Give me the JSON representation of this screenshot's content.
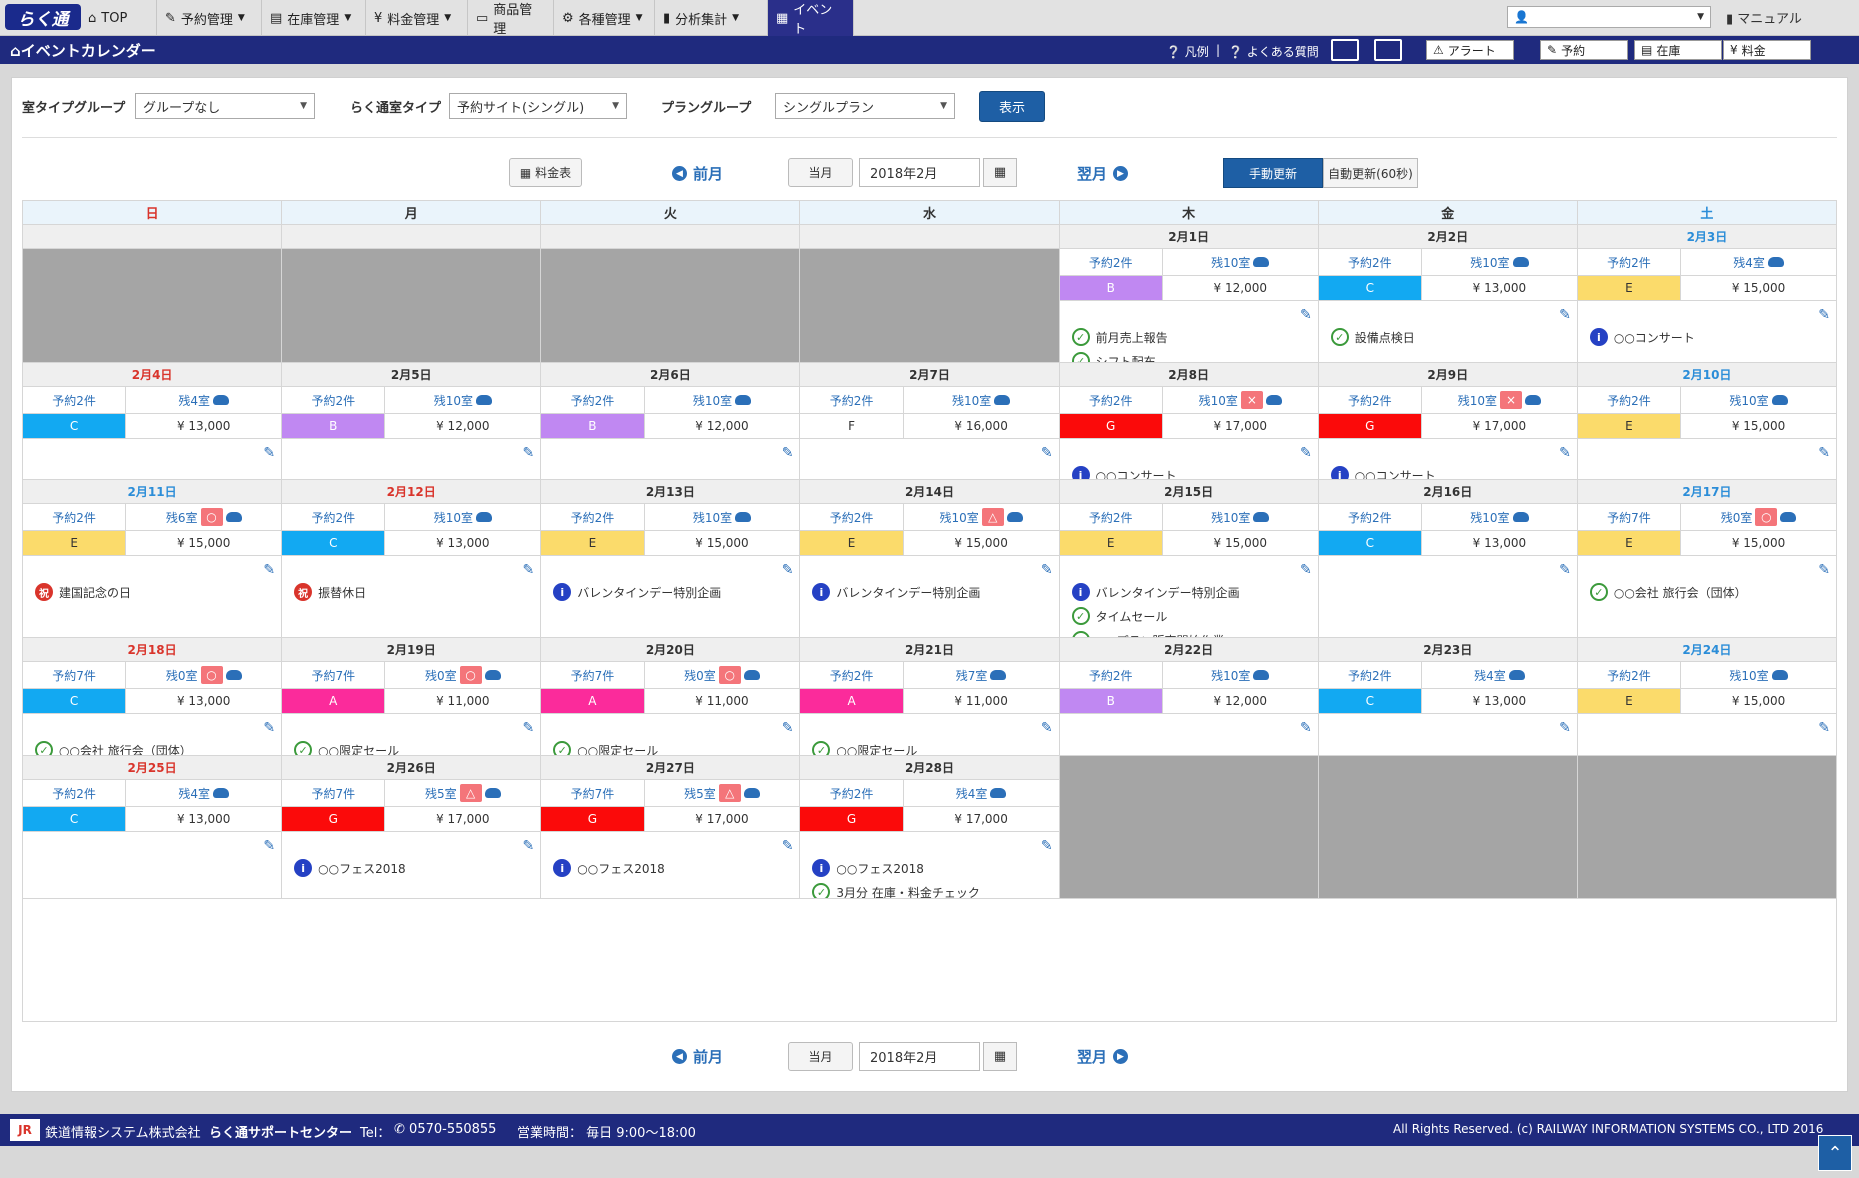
{
  "nav": {
    "logo": "らく通",
    "items": [
      {
        "label": "TOP",
        "icon": "home-icon",
        "dropdown": false,
        "active": false
      },
      {
        "label": "予約管理",
        "icon": "edit-icon",
        "dropdown": true,
        "active": false
      },
      {
        "label": "在庫管理",
        "icon": "list-icon",
        "dropdown": true,
        "active": false
      },
      {
        "label": "料金管理",
        "icon": "yen-icon",
        "dropdown": true,
        "active": false
      },
      {
        "label": "商品管理",
        "icon": "tag-icon",
        "dropdown": false,
        "active": false
      },
      {
        "label": "各種管理",
        "icon": "gear-icon",
        "dropdown": true,
        "active": false
      },
      {
        "label": "分析集計",
        "icon": "chart-icon",
        "dropdown": true,
        "active": false
      },
      {
        "label": "イベント",
        "icon": "calendar-icon",
        "dropdown": false,
        "active": true
      }
    ],
    "user_select": "",
    "manual": "マニュアル"
  },
  "titlebar": {
    "title": "イベントカレンダー",
    "legend": "凡例",
    "faq": "よくある質問",
    "alert": "アラート",
    "reserve": "予約",
    "stock": "在庫",
    "price": "料金"
  },
  "filters": {
    "roomtype_label": "室タイプグループ",
    "roomtype_value": "グループなし",
    "rakutsu_label": "らく通室タイプ",
    "rakutsu_value": "予約サイト(シングル)",
    "plan_label": "プラングループ",
    "plan_value": "シングルプラン",
    "show": "表示"
  },
  "controls": {
    "price_table": "料金表",
    "prev": "前月",
    "current": "当月",
    "month": "2018年2月",
    "next": "翌月",
    "manual_update": "手動更新",
    "auto_update": "自動更新(60秒)"
  },
  "calendar": {
    "weekdays": [
      "日",
      "月",
      "火",
      "水",
      "木",
      "金",
      "土"
    ],
    "weeks": [
      [
        null,
        null,
        null,
        null,
        {
          "date": "2月1日",
          "type": "",
          "resv": "予約2件",
          "remain": "残10室",
          "status": "",
          "plan": "B",
          "color": "#c088f2",
          "price": "¥ 12,000",
          "events": [
            {
              "t": "check",
              "text": "前月売上報告"
            },
            {
              "t": "check",
              "text": "シフト配布"
            }
          ]
        },
        {
          "date": "2月2日",
          "type": "",
          "resv": "予約2件",
          "remain": "残10室",
          "status": "",
          "plan": "C",
          "color": "#12a9f2",
          "price": "¥ 13,000",
          "events": [
            {
              "t": "check",
              "text": "設備点検日"
            }
          ]
        },
        {
          "date": "2月3日",
          "type": "sat",
          "resv": "予約2件",
          "remain": "残4室",
          "status": "",
          "plan": "E",
          "color": "#fbdb6b",
          "price": "¥ 15,000",
          "events": [
            {
              "t": "info",
              "text": "○○コンサート"
            }
          ]
        }
      ],
      [
        {
          "date": "2月4日",
          "type": "sun",
          "resv": "予約2件",
          "remain": "残4室",
          "status": "",
          "plan": "C",
          "color": "#12a9f2",
          "price": "¥ 13,000",
          "events": []
        },
        {
          "date": "2月5日",
          "type": "",
          "resv": "予約2件",
          "remain": "残10室",
          "status": "",
          "plan": "B",
          "color": "#c088f2",
          "price": "¥ 12,000",
          "events": []
        },
        {
          "date": "2月6日",
          "type": "",
          "resv": "予約2件",
          "remain": "残10室",
          "status": "",
          "plan": "B",
          "color": "#c088f2",
          "price": "¥ 12,000",
          "events": []
        },
        {
          "date": "2月7日",
          "type": "",
          "resv": "予約2件",
          "remain": "残10室",
          "status": "",
          "plan": "F",
          "color": "#ffffff",
          "price": "¥ 16,000",
          "events": []
        },
        {
          "date": "2月8日",
          "type": "",
          "resv": "予約2件",
          "remain": "残10室",
          "status": "×",
          "plan": "G",
          "color": "#fb0a0a",
          "price": "¥ 17,000",
          "events": [
            {
              "t": "info",
              "text": "○○コンサート"
            }
          ]
        },
        {
          "date": "2月9日",
          "type": "",
          "resv": "予約2件",
          "remain": "残10室",
          "status": "×",
          "plan": "G",
          "color": "#fb0a0a",
          "price": "¥ 17,000",
          "events": [
            {
              "t": "info",
              "text": "○○コンサート"
            }
          ]
        },
        {
          "date": "2月10日",
          "type": "sat",
          "resv": "予約2件",
          "remain": "残10室",
          "status": "",
          "plan": "E",
          "color": "#fbdb6b",
          "price": "¥ 15,000",
          "events": []
        }
      ],
      [
        {
          "date": "2月11日",
          "type": "sat",
          "resv": "予約2件",
          "remain": "残6室",
          "status": "○",
          "plan": "E",
          "color": "#fbdb6b",
          "price": "¥ 15,000",
          "events": [
            {
              "t": "holiday",
              "text": "建国記念の日"
            }
          ]
        },
        {
          "date": "2月12日",
          "type": "sun",
          "resv": "予約2件",
          "remain": "残10室",
          "status": "",
          "plan": "C",
          "color": "#12a9f2",
          "price": "¥ 13,000",
          "events": [
            {
              "t": "holiday",
              "text": "振替休日"
            }
          ]
        },
        {
          "date": "2月13日",
          "type": "",
          "resv": "予約2件",
          "remain": "残10室",
          "status": "",
          "plan": "E",
          "color": "#fbdb6b",
          "price": "¥ 15,000",
          "events": [
            {
              "t": "info",
              "text": "バレンタインデー特別企画"
            }
          ]
        },
        {
          "date": "2月14日",
          "type": "",
          "resv": "予約2件",
          "remain": "残10室",
          "status": "△",
          "plan": "E",
          "color": "#fbdb6b",
          "price": "¥ 15,000",
          "events": [
            {
              "t": "info",
              "text": "バレンタインデー特別企画"
            }
          ]
        },
        {
          "date": "2月15日",
          "type": "",
          "resv": "予約2件",
          "remain": "残10室",
          "status": "",
          "plan": "E",
          "color": "#fbdb6b",
          "price": "¥ 15,000",
          "events": [
            {
              "t": "info",
              "text": "バレンタインデー特別企画"
            },
            {
              "t": "check",
              "text": "タイムセール"
            },
            {
              "t": "check",
              "text": "○○プラン販売開始作業"
            }
          ]
        },
        {
          "date": "2月16日",
          "type": "",
          "resv": "予約2件",
          "remain": "残10室",
          "status": "",
          "plan": "C",
          "color": "#12a9f2",
          "price": "¥ 13,000",
          "events": []
        },
        {
          "date": "2月17日",
          "type": "sat",
          "resv": "予約7件",
          "remain": "残0室",
          "status": "○",
          "plan": "E",
          "color": "#fbdb6b",
          "price": "¥ 15,000",
          "events": [
            {
              "t": "check",
              "text": "○○会社 旅行会（団体）"
            }
          ]
        }
      ],
      [
        {
          "date": "2月18日",
          "type": "sun",
          "resv": "予約7件",
          "remain": "残0室",
          "status": "○",
          "plan": "C",
          "color": "#12a9f2",
          "price": "¥ 13,000",
          "events": [
            {
              "t": "check",
              "text": "○○会社 旅行会（団体）"
            }
          ]
        },
        {
          "date": "2月19日",
          "type": "",
          "resv": "予約7件",
          "remain": "残0室",
          "status": "○",
          "plan": "A",
          "color": "#fb2b9b",
          "price": "¥ 11,000",
          "events": [
            {
              "t": "check",
              "text": "○○限定セール"
            }
          ]
        },
        {
          "date": "2月20日",
          "type": "",
          "resv": "予約7件",
          "remain": "残0室",
          "status": "○",
          "plan": "A",
          "color": "#fb2b9b",
          "price": "¥ 11,000",
          "events": [
            {
              "t": "check",
              "text": "○○限定セール"
            }
          ]
        },
        {
          "date": "2月21日",
          "type": "",
          "resv": "予約2件",
          "remain": "残7室",
          "status": "",
          "plan": "A",
          "color": "#fb2b9b",
          "price": "¥ 11,000",
          "events": [
            {
              "t": "check",
              "text": "○○限定セール"
            }
          ]
        },
        {
          "date": "2月22日",
          "type": "",
          "resv": "予約2件",
          "remain": "残10室",
          "status": "",
          "plan": "B",
          "color": "#c088f2",
          "price": "¥ 12,000",
          "events": []
        },
        {
          "date": "2月23日",
          "type": "",
          "resv": "予約2件",
          "remain": "残4室",
          "status": "",
          "plan": "C",
          "color": "#12a9f2",
          "price": "¥ 13,000",
          "events": []
        },
        {
          "date": "2月24日",
          "type": "sat",
          "resv": "予約2件",
          "remain": "残10室",
          "status": "",
          "plan": "E",
          "color": "#fbdb6b",
          "price": "¥ 15,000",
          "events": []
        }
      ],
      [
        {
          "date": "2月25日",
          "type": "sun",
          "resv": "予約2件",
          "remain": "残4室",
          "status": "",
          "plan": "C",
          "color": "#12a9f2",
          "price": "¥ 13,000",
          "events": []
        },
        {
          "date": "2月26日",
          "type": "",
          "resv": "予約7件",
          "remain": "残5室",
          "status": "△",
          "plan": "G",
          "color": "#fb0a0a",
          "price": "¥ 17,000",
          "events": [
            {
              "t": "info",
              "text": "○○フェス2018"
            }
          ]
        },
        {
          "date": "2月27日",
          "type": "",
          "resv": "予約7件",
          "remain": "残5室",
          "status": "△",
          "plan": "G",
          "color": "#fb0a0a",
          "price": "¥ 17,000",
          "events": [
            {
              "t": "info",
              "text": "○○フェス2018"
            }
          ]
        },
        {
          "date": "2月28日",
          "type": "",
          "resv": "予約2件",
          "remain": "残4室",
          "status": "",
          "plan": "G",
          "color": "#fb0a0a",
          "price": "¥ 17,000",
          "events": [
            {
              "t": "info",
              "text": "○○フェス2018"
            },
            {
              "t": "check",
              "text": "3月分 在庫・料金チェック"
            }
          ]
        },
        null,
        null,
        null
      ]
    ]
  },
  "footer": {
    "company": "鉄道情報システム株式会社",
    "support": "らく通サポートセンター",
    "tel": "Tel：",
    "phone": "0570-550855",
    "hours": "営業時間： 毎日 9:00～18:00",
    "copyright": "All Rights Reserved. (c) RAILWAY INFORMATION SYSTEMS CO., LTD 2016",
    "logo_text": "JR"
  }
}
